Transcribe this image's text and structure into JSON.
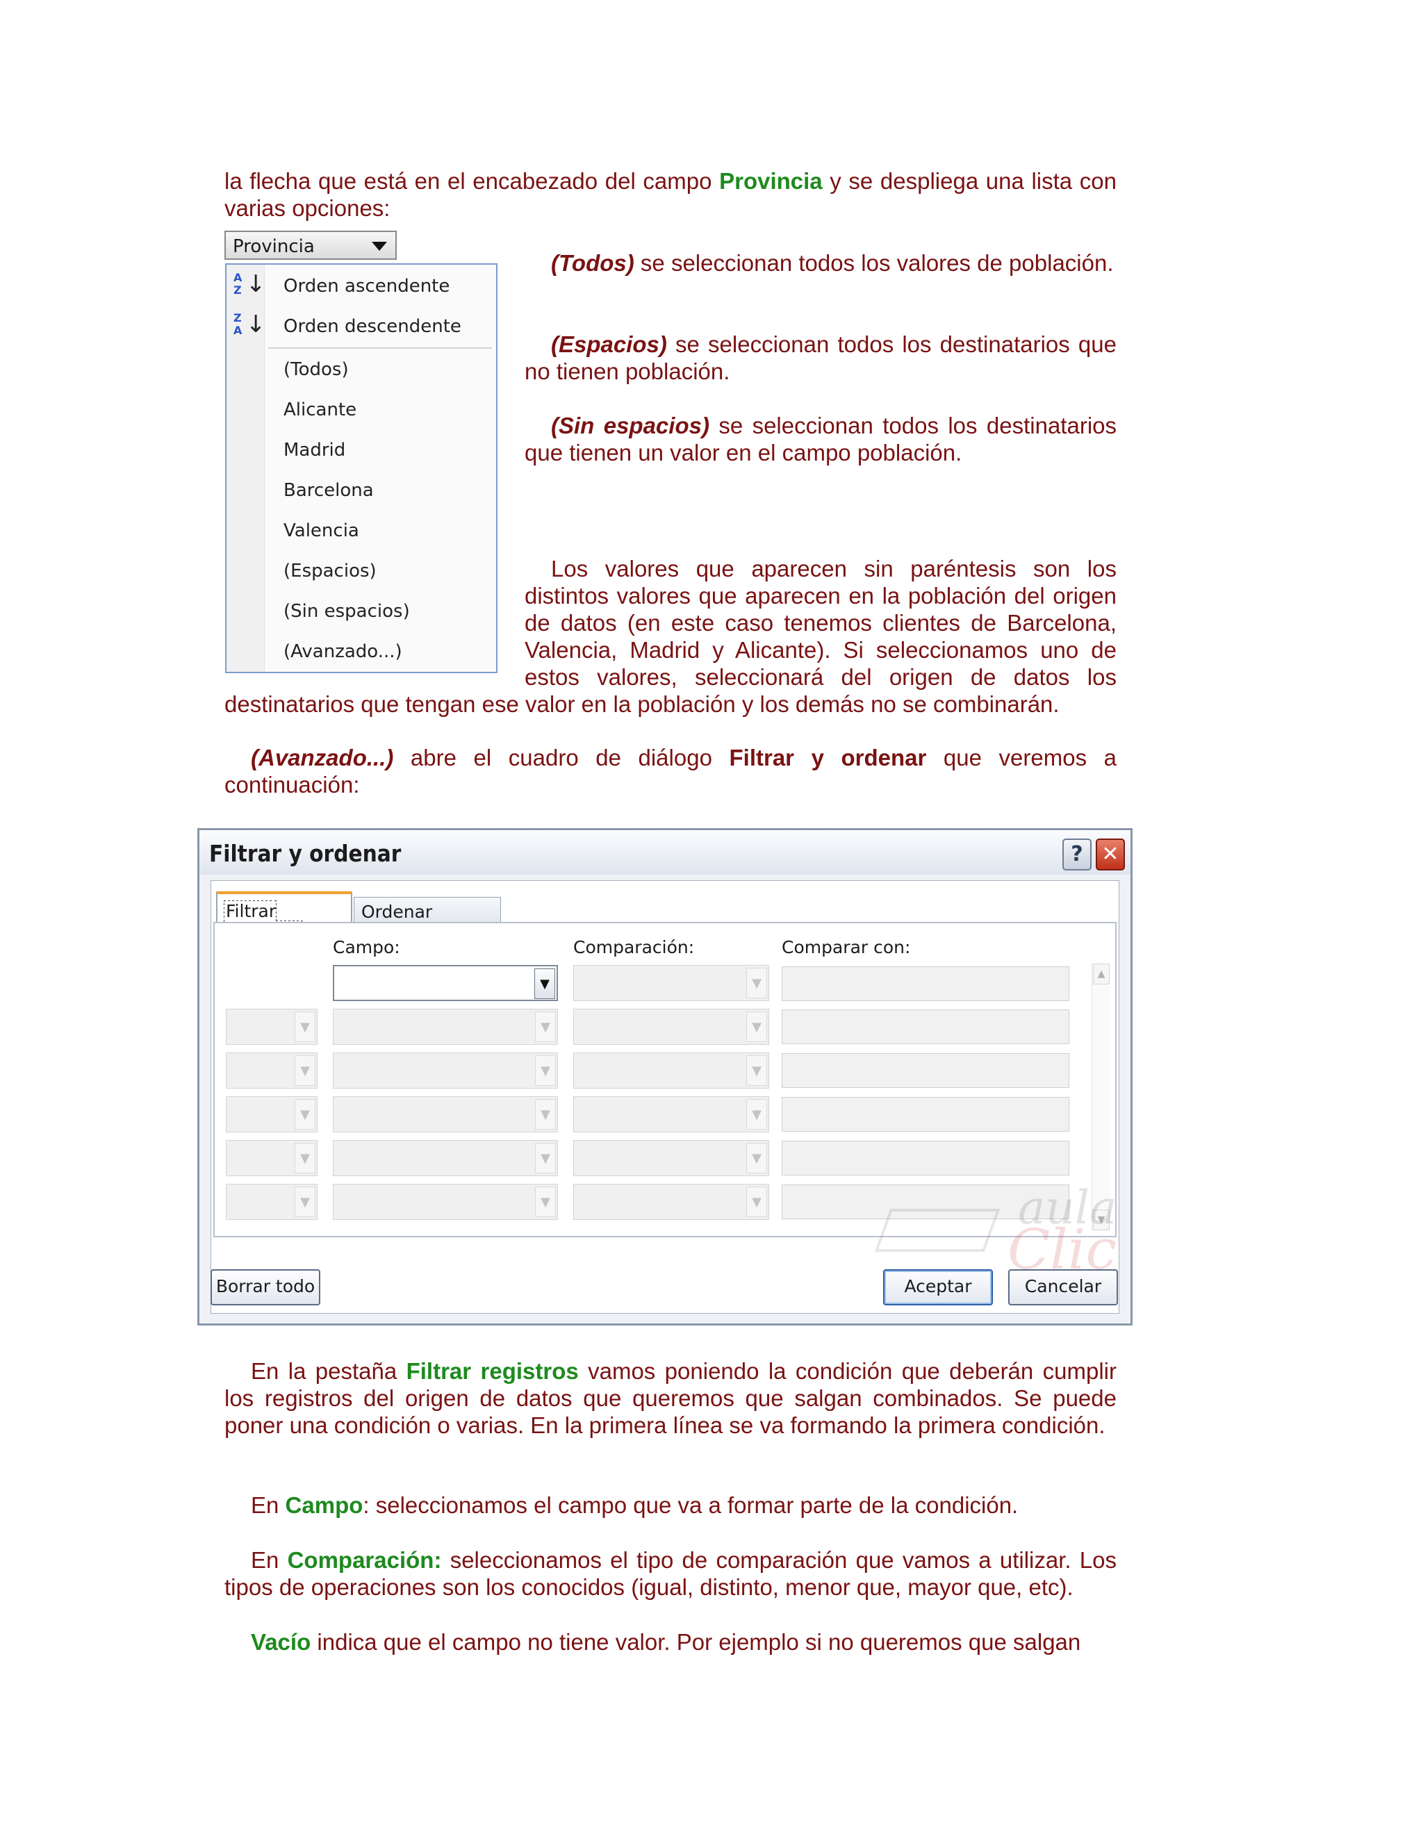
{
  "intro": {
    "text1": "la flecha que está en el encabezado del campo ",
    "highlight": "Provincia",
    "text2": " y se despliega una lista con varias opciones:"
  },
  "dropdown": {
    "header_label": "Provincia",
    "sort_items": [
      {
        "label": "Orden ascendente",
        "icon_top": "A",
        "icon_bottom": "Z"
      },
      {
        "label": "Orden descendente",
        "icon_top": "Z",
        "icon_bottom": "A"
      }
    ],
    "values": [
      "(Todos)",
      "Alicante",
      "Madrid",
      "Barcelona",
      "Valencia",
      "(Espacios)",
      "(Sin espacios)",
      "(Avanzado...)"
    ]
  },
  "side_paragraphs": {
    "todos": {
      "term": "(Todos)",
      "text": " se seleccionan todos los valores de población."
    },
    "espacios": {
      "term": "(Espacios)",
      "text": " se seleccionan todos los destinatarios que no tienen población."
    },
    "sin_espacios": {
      "term": "(Sin espacios)",
      "text": " se seleccionan todos los destinatarios que tienen un valor en el campo población."
    },
    "valores": "Los valores que aparecen sin paréntesis son los distintos valores que aparecen en la población del origen de datos (en este caso tenemos clientes de Barcelona, Valencia, Madrid y Alicante). Si seleccionamos uno de estos valores, seleccionará del origen de datos los",
    "valores_cont": "destinatarios que tengan ese valor en la población y los demás no se combinarán."
  },
  "avanzado": {
    "term": "(Avanzado...)",
    "text1": " abre el cuadro de diálogo ",
    "dialog_name": "Filtrar y ordenar",
    "text2": " que veremos a continuación:"
  },
  "dialog": {
    "title": "Filtrar y ordenar",
    "help_label": "?",
    "close_label": "✕",
    "tabs": [
      "Filtrar registros",
      "Ordenar registros"
    ],
    "columns": {
      "campo": "Campo:",
      "comparacion": "Comparación:",
      "comparar_con": "Comparar con:"
    },
    "buttons": {
      "borrar": "Borrar todo",
      "aceptar": "Aceptar",
      "cancelar": "Cancelar"
    },
    "watermark": {
      "line1": "aula",
      "line2": "Clic"
    }
  },
  "body_paragraphs": {
    "p1": {
      "t1": "En la pestaña ",
      "h": "Filtrar registros",
      "t2": " vamos poniendo la condición que deberán cumplir los registros del origen de datos que queremos que salgan combinados. Se puede poner una condición o varias. En la primera línea se va formando la primera condición."
    },
    "p2": {
      "t1": "En ",
      "h": "Campo",
      "t2": ": seleccionamos el campo que va a formar parte de la condición."
    },
    "p3": {
      "t1": "En ",
      "h": "Comparación:",
      "t2": " seleccionamos el tipo de comparación que vamos a utilizar. Los tipos de operaciones son los conocidos (igual, distinto, menor que, mayor que, etc)."
    },
    "p4": {
      "h": "Vacío",
      "t2": " indica que el campo no tiene valor. Por ejemplo si no queremos que salgan"
    }
  },
  "colors": {
    "text": "#7a1212",
    "highlight": "#1e8a1e"
  },
  "icons": [
    "sort-ascending-icon",
    "sort-descending-icon",
    "dropdown-arrow-icon",
    "help-icon",
    "close-icon"
  ]
}
